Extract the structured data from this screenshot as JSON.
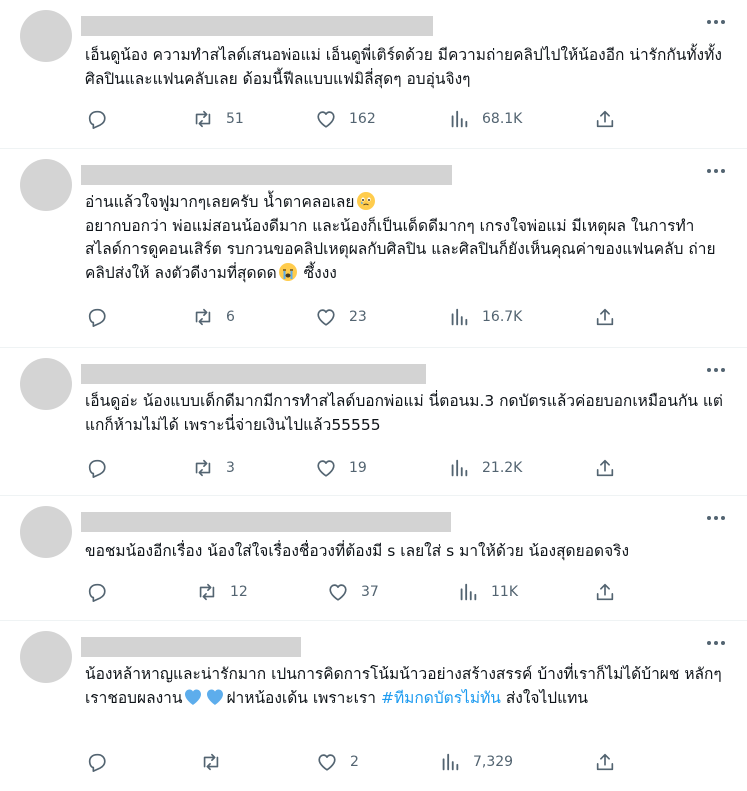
{
  "colors": {
    "text": "#0f1419",
    "muted": "#536471",
    "hashtag": "#1d9bf0",
    "placeholder": "#d3d3d3",
    "divider": "#eff3f4"
  },
  "replies": [
    {
      "text": "เอ็นดูน้อง ความทำสไลด์เสนอพ่อแม่ เอ็นดูพี่เติร์ดด้วย มีความถ่ายคลิปไปให้น้องอีก น่ารักกันทั้งทั้งศิลปินและแฟนคลับเลย ด้อมนี้ฟีลแบบแฟมิลี่สุดๆ อบอุ่นจิงๆ",
      "reply_count": "",
      "retweets": "51",
      "likes": "162",
      "views": "68.1K"
    },
    {
      "line1_text": "อ่านแล้วใจฟูมากๆเลยครับ น้ำตาคลอเลย",
      "line1_emoji": "face-holding-back-tears-emoji",
      "body_text": "อยากบอกว่า พ่อแม่สอนน้องดีมาก และน้องก็เป็นเด็ดดีมากๆ เกรงใจพ่อแม่ มีเหตุผล ในการทำสไลด์การดูคอนเสิร์ต รบกวนขอคลิปเหตุผลกับศิลปิน และศิลปินก็ยังเห็นคุณค่าของแฟนคลับ ถ่ายคลิปส่งให้  ลงตัวดีงามที่สุดดด",
      "body_emoji": "loudly-crying-face-emoji",
      "tail_text": " ซึ้งงง",
      "reply_count": "",
      "retweets": "6",
      "likes": "23",
      "views": "16.7K"
    },
    {
      "text": "เอ็นดูอ่ะ น้องแบบเด็กดีมากมีการทำสไลด์บอกพ่อแม่ นี่ตอนม.3 กดบัตรแล้วค่อยบอกเหมือนกัน แต่แกก็ห้ามไม่ได้ เพราะนี่จ่ายเงินไปแล้ว55555",
      "reply_count": "",
      "retweets": "3",
      "likes": "19",
      "views": "21.2K"
    },
    {
      "text": "ขอชมน้องอีกเรื่อง น้องใส่ใจเรื่องชื่อวงที่ต้องมี s เลยใส่ s มาให้ด้วย น้องสุดยอดจริง",
      "reply_count": "",
      "retweets": "12",
      "likes": "37",
      "views": "11K"
    },
    {
      "text_before": "น้องหล้าหาญและน่ารักมาก เปนการคิดการโน้มน้าวอย่างสร้างสรรค์ บ้างที่เราก็ไม่ได้บ้าผช หลักๆเราชอบผลงาน",
      "emoji": "blue-heart-emoji",
      "text_middle": "ฝาหน้องเด้น เพราะเรา ",
      "hashtag": "#ทีมกดบัตรไม่ทัน",
      "text_after": " ส่งใจไปแทน",
      "reply_count": "",
      "retweets": "",
      "likes": "2",
      "views": "7,329"
    }
  ]
}
